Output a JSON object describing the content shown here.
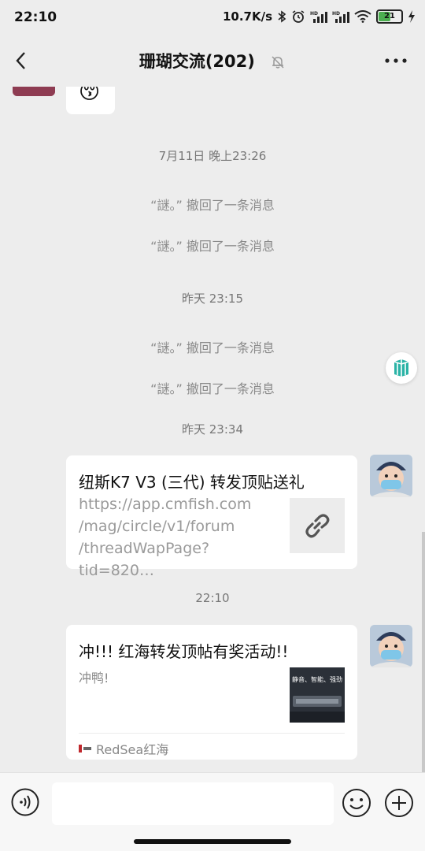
{
  "status_bar": {
    "time": "22:10",
    "network_speed": "10.7K/s",
    "battery_level": "21",
    "icons": [
      "bluetooth-icon",
      "alarm-icon",
      "signal-hd-icon",
      "signal-hd-icon",
      "wifi-icon",
      "battery-icon",
      "charging-icon"
    ]
  },
  "header": {
    "title": "珊瑚交流(202)",
    "icons": [
      "back-arrow-icon",
      "muted-bell-icon",
      "more-icon"
    ]
  },
  "messages": {
    "emoji_message": "😚",
    "timestamps": [
      "7月11日 晚上23:26",
      "昨天 23:15",
      "昨天 23:34",
      "22:10"
    ],
    "recall_notices": [
      "“謎。” 撤回了一条消息",
      "“謎。” 撤回了一条消息",
      "“謎。” 撤回了一条消息",
      "“謎。” 撤回了一条消息"
    ],
    "link_card": {
      "title": "纽斯K7 V3 (三代) 转发顶贴送礼",
      "url_lines": [
        "https://app.cmfish.com",
        "/mag/circle/v1/forum",
        "/threadWapPage?tid=820…"
      ],
      "icon": "link-icon"
    },
    "article_card": {
      "title": "冲!!! 红海转发顶帖有奖活动!!",
      "description": "冲鸭!",
      "thumbnail_text": "静音、智能、强劲",
      "source": "RedSea红海"
    }
  },
  "input_bar": {
    "icons": [
      "voice-icon",
      "emoji-icon",
      "plus-icon"
    ],
    "input_value": ""
  },
  "colors": {
    "background": "#ededed",
    "bubble": "#ffffff",
    "system_text": "#8a8a8a",
    "link_text": "#9a9a9a"
  }
}
